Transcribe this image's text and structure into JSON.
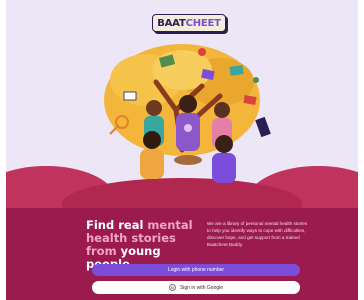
{
  "brand": {
    "logo_part1": "BAAT",
    "logo_part2": "CHEET"
  },
  "hero": {
    "headline_part1": "Find real ",
    "headline_accent": "mental health stories from",
    "headline_part2": " young people",
    "description": "We are a library of personal mental health stories to help you identify ways to cope with difficulties, discover hope, and get support from a trained Baatcheet Buddy."
  },
  "actions": {
    "phone_login_label": "Login with phone number",
    "google_signin_label": "Sign in with Google"
  },
  "icons": {
    "logo": "baatcheet-logo",
    "google": "google-icon"
  },
  "colors": {
    "hero_bg": "#ece6f6",
    "panel_bg": "#9c1b4f",
    "accent_text": "#f2a6c4",
    "primary_button": "#7c4ddb"
  }
}
